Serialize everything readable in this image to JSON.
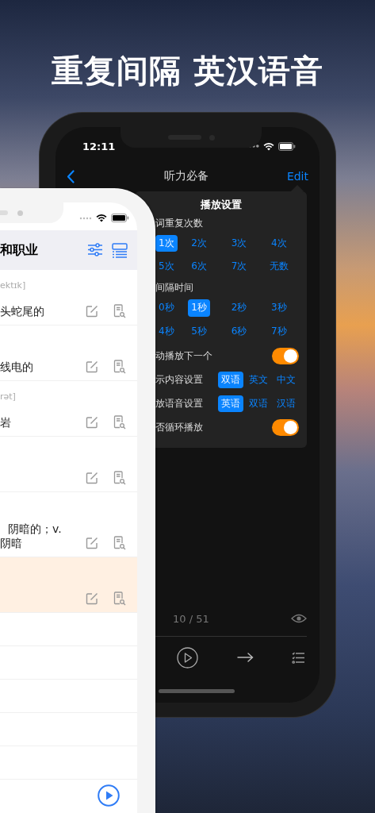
{
  "headline": "重复间隔 英汉语音",
  "player": {
    "status_bar": {
      "time": "12:11"
    },
    "nav": {
      "title": "听力必备",
      "action": "Edit"
    },
    "settings": {
      "title": "播放设置",
      "sections": [
        {
          "kind": "options",
          "label": "词重复次数",
          "options": [
            {
              "label": "1次",
              "selected": true
            },
            {
              "label": "2次",
              "selected": false
            },
            {
              "label": "3次",
              "selected": false
            },
            {
              "label": "4次",
              "selected": false
            },
            {
              "label": "5次",
              "selected": false
            },
            {
              "label": "6次",
              "selected": false
            },
            {
              "label": "7次",
              "selected": false
            },
            {
              "label": "无数",
              "selected": false
            }
          ]
        },
        {
          "kind": "options",
          "label": "间隔时间",
          "options": [
            {
              "label": "0秒",
              "selected": false
            },
            {
              "label": "1秒",
              "selected": true
            },
            {
              "label": "2秒",
              "selected": false
            },
            {
              "label": "3秒",
              "selected": false
            },
            {
              "label": "4秒",
              "selected": false
            },
            {
              "label": "5秒",
              "selected": false
            },
            {
              "label": "6秒",
              "selected": false
            },
            {
              "label": "7秒",
              "selected": false
            }
          ]
        },
        {
          "kind": "toggle",
          "label": "动播放下一个",
          "on": true
        },
        {
          "kind": "segmented",
          "label": "示内容设置",
          "options": [
            {
              "label": "双语",
              "selected": true
            },
            {
              "label": "英文",
              "selected": false
            },
            {
              "label": "中文",
              "selected": false
            }
          ]
        },
        {
          "kind": "segmented",
          "label": "放语音设置",
          "options": [
            {
              "label": "英语",
              "selected": true
            },
            {
              "label": "双语",
              "selected": false
            },
            {
              "label": "汉语",
              "selected": false
            }
          ]
        },
        {
          "kind": "toggle",
          "label": "否循环播放",
          "on": true
        }
      ]
    },
    "counter": "10 / 51"
  },
  "word_list": {
    "title": "和职业",
    "rows": [
      {
        "kind": "word",
        "phonetic": "ektɪk]",
        "meaning": [
          "头蛇尾的"
        ],
        "selected": false
      },
      {
        "kind": "word",
        "meaning": [
          "线电的"
        ],
        "selected": false
      },
      {
        "kind": "word",
        "phonetic": "rət]",
        "meaning": [
          "岩"
        ],
        "selected": false
      },
      {
        "kind": "word",
        "selected": false
      },
      {
        "kind": "word",
        "meaning": [
          "阴暗的；v.",
          "阴暗"
        ],
        "selected": false
      },
      {
        "kind": "word",
        "selected": true
      },
      {
        "kind": "blank",
        "selected": false
      },
      {
        "kind": "blank",
        "selected": false
      },
      {
        "kind": "blank",
        "selected": false
      },
      {
        "kind": "blank",
        "selected": false
      },
      {
        "kind": "blank",
        "selected": false
      }
    ]
  }
}
